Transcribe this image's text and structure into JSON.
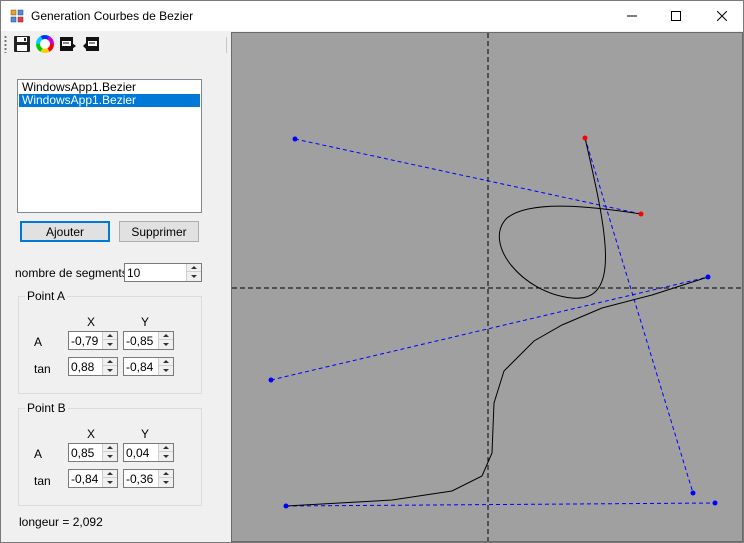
{
  "window": {
    "title": "Generation Courbes de Bezier"
  },
  "toolbar": {
    "icons": [
      "save-icon",
      "color-wheel-icon",
      "csv-export-icon",
      "csv-import-icon"
    ]
  },
  "curve_list": {
    "items": [
      {
        "label": "WindowsApp1.Bezier",
        "selected": false
      },
      {
        "label": "WindowsApp1.Bezier",
        "selected": true
      }
    ]
  },
  "buttons": {
    "add_label": "Ajouter",
    "remove_label": "Supprimer"
  },
  "segments": {
    "label": "nombre de segments",
    "value": "10"
  },
  "pointA": {
    "title": "Point A",
    "x_header": "X",
    "y_header": "Y",
    "row_a_label": "A",
    "row_tan_label": "tan",
    "a_x": "-0,79",
    "a_y": "-0,85",
    "tan_x": "0,88",
    "tan_y": "-0,84"
  },
  "pointB": {
    "title": "Point B",
    "x_header": "X",
    "y_header": "Y",
    "row_a_label": "A",
    "row_tan_label": "tan",
    "a_x": "0,85",
    "a_y": "0,04",
    "tan_x": "-0,84",
    "tan_y": "-0,36"
  },
  "length_text": "longeur = 2,092",
  "colors": {
    "canvas_bg": "#a0a0a0",
    "control_line": "#0000ff",
    "curve": "#000000",
    "selected_point": "#ff0000",
    "selection": "#0078d7"
  }
}
